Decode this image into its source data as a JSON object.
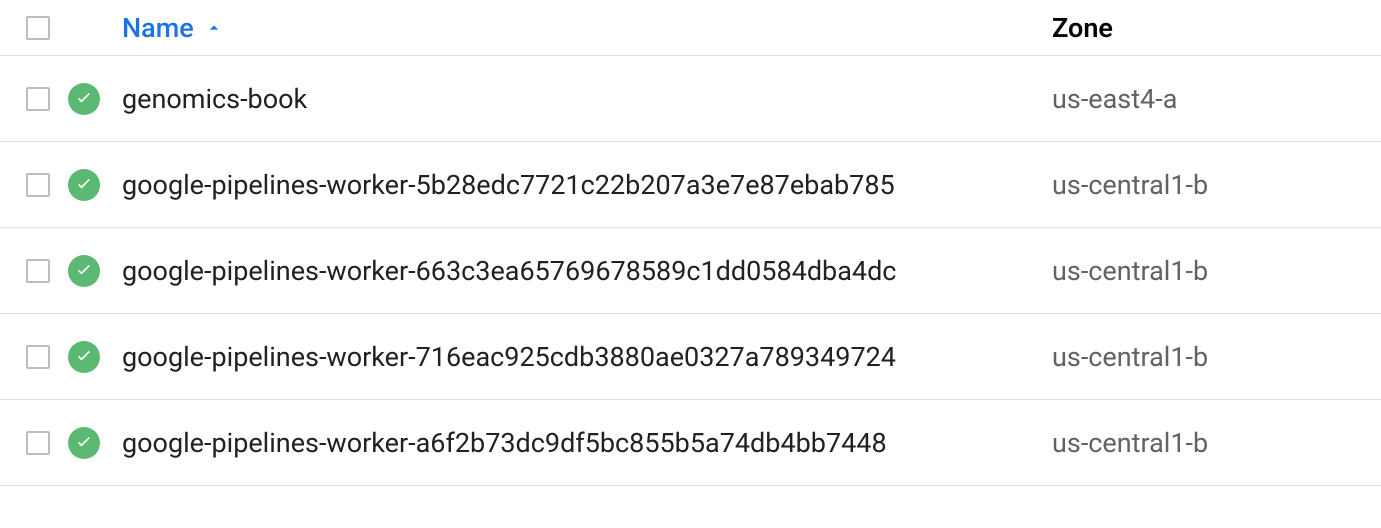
{
  "table": {
    "headers": {
      "name": "Name",
      "zone": "Zone"
    },
    "sort": {
      "column": "name",
      "direction": "asc"
    },
    "rows": [
      {
        "name": "genomics-book",
        "zone": "us-east4-a",
        "status": "running"
      },
      {
        "name": "google-pipelines-worker-5b28edc7721c22b207a3e7e87ebab785",
        "zone": "us-central1-b",
        "status": "running"
      },
      {
        "name": "google-pipelines-worker-663c3ea65769678589c1dd0584dba4dc",
        "zone": "us-central1-b",
        "status": "running"
      },
      {
        "name": "google-pipelines-worker-716eac925cdb3880ae0327a789349724",
        "zone": "us-central1-b",
        "status": "running"
      },
      {
        "name": "google-pipelines-worker-a6f2b73dc9df5bc855b5a74db4bb7448",
        "zone": "us-central1-b",
        "status": "running"
      }
    ]
  },
  "colors": {
    "link": "#1a73e8",
    "status_ok": "#5bb974",
    "muted": "#5f6368"
  }
}
